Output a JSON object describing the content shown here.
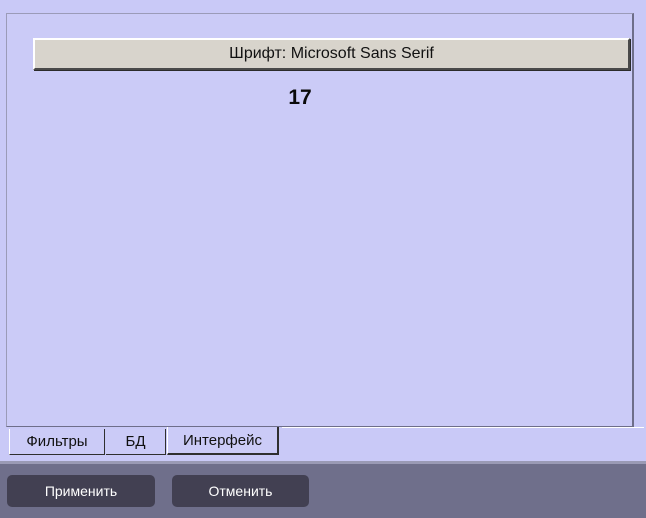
{
  "panel": {
    "font_button_label": "Шрифт: Microsoft Sans Serif",
    "font_size_value": "17"
  },
  "tabs": [
    {
      "label": "Фильтры",
      "active": false
    },
    {
      "label": "БД",
      "active": false
    },
    {
      "label": "Интерфейс",
      "active": true
    }
  ],
  "actions": {
    "apply_label": "Применить",
    "cancel_label": "Отменить"
  },
  "colors": {
    "panel_background": "#cbcbf7",
    "bottom_bar": "#6f6f8b",
    "action_button": "#424052"
  }
}
